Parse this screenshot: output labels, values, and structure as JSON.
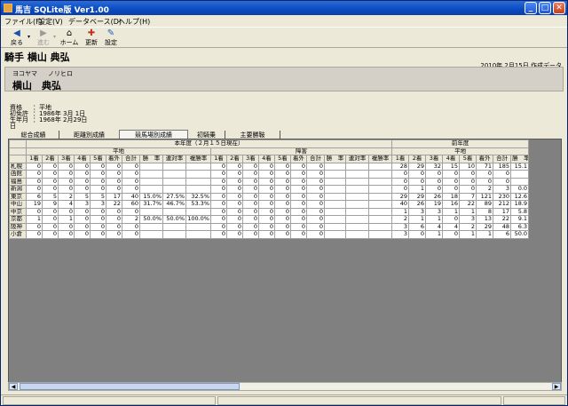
{
  "window": {
    "title": "馬吉 SQLite版  Ver1.00"
  },
  "menu": [
    "ファイル(F)",
    "設定(V)",
    "データベース(D)",
    "ヘルプ(H)"
  ],
  "toolbar": {
    "back": "戻る",
    "forward": "進む",
    "home": "ホーム",
    "refresh": "更新",
    "settings": "設定"
  },
  "page_title": "騎手 横山 典弘",
  "created_note": "2010年 2月15日 作成データ",
  "jockey": {
    "kana_last": "ヨコヤマ",
    "kana_first": "ノリヒロ",
    "name": "横山　典弘"
  },
  "info": [
    {
      "k": "資格",
      "v": "：平地"
    },
    {
      "k": "初免許",
      "v": "：1986年 3月 1日"
    },
    {
      "k": "生年月日",
      "v": "：1968年 2月29日"
    }
  ],
  "tabs": [
    "総合成績",
    "距離別成績",
    "競馬場別成績",
    "初騎乗",
    "主要勝鞍"
  ],
  "grid": {
    "year_header": "本年度（２月１５日現在）",
    "prev_header": "前年度",
    "flat": "平地",
    "jump": "障害",
    "flat_cols": [
      "1着",
      "2着",
      "3着",
      "4着",
      "5着",
      "着外",
      "合計",
      "勝　率",
      "連対率",
      "複勝率"
    ],
    "jump_cols": [
      "1着",
      "2着",
      "3着",
      "4着",
      "5着",
      "着外",
      "合計",
      "勝　率",
      "連対率",
      "複勝率"
    ],
    "prev_cols": [
      "1着",
      "2着",
      "3着",
      "4着",
      "5着",
      "着外",
      "合計",
      "勝　率"
    ],
    "rows": [
      {
        "c": "札幌",
        "f": [
          "0",
          "0",
          "0",
          "0",
          "0",
          "0",
          "0",
          "",
          "",
          ""
        ],
        "j": [
          "0",
          "0",
          "0",
          "0",
          "0",
          "0",
          "0",
          "",
          "",
          ""
        ],
        "p": [
          "28",
          "29",
          "32",
          "15",
          "10",
          "71",
          "185",
          "15.1"
        ]
      },
      {
        "c": "函館",
        "f": [
          "0",
          "0",
          "0",
          "0",
          "0",
          "0",
          "0",
          "",
          "",
          ""
        ],
        "j": [
          "0",
          "0",
          "0",
          "0",
          "0",
          "0",
          "0",
          "",
          "",
          ""
        ],
        "p": [
          "0",
          "0",
          "0",
          "0",
          "0",
          "0",
          "0",
          ""
        ]
      },
      {
        "c": "福島",
        "f": [
          "0",
          "0",
          "0",
          "0",
          "0",
          "0",
          "0",
          "",
          "",
          ""
        ],
        "j": [
          "0",
          "0",
          "0",
          "0",
          "0",
          "0",
          "0",
          "",
          "",
          ""
        ],
        "p": [
          "0",
          "0",
          "0",
          "0",
          "0",
          "0",
          "0",
          ""
        ]
      },
      {
        "c": "新潟",
        "f": [
          "0",
          "0",
          "0",
          "0",
          "0",
          "0",
          "0",
          "",
          "",
          ""
        ],
        "j": [
          "0",
          "0",
          "0",
          "0",
          "0",
          "0",
          "0",
          "",
          "",
          ""
        ],
        "p": [
          "0",
          "1",
          "0",
          "0",
          "0",
          "2",
          "3",
          "0.0"
        ]
      },
      {
        "c": "東京",
        "f": [
          "6",
          "5",
          "2",
          "5",
          "5",
          "17",
          "40",
          "15.0%",
          "27.5%",
          "32.5%"
        ],
        "j": [
          "0",
          "0",
          "0",
          "0",
          "0",
          "0",
          "0",
          "",
          "",
          ""
        ],
        "p": [
          "29",
          "29",
          "26",
          "18",
          "7",
          "121",
          "230",
          "12.6"
        ]
      },
      {
        "c": "中山",
        "f": [
          "19",
          "9",
          "4",
          "3",
          "3",
          "22",
          "60",
          "31.7%",
          "46.7%",
          "53.3%"
        ],
        "j": [
          "0",
          "0",
          "0",
          "0",
          "0",
          "0",
          "0",
          "",
          "",
          ""
        ],
        "p": [
          "40",
          "26",
          "19",
          "16",
          "22",
          "89",
          "212",
          "18.9"
        ]
      },
      {
        "c": "中京",
        "f": [
          "0",
          "0",
          "0",
          "0",
          "0",
          "0",
          "0",
          "",
          "",
          ""
        ],
        "j": [
          "0",
          "0",
          "0",
          "0",
          "0",
          "0",
          "0",
          "",
          "",
          ""
        ],
        "p": [
          "1",
          "3",
          "3",
          "1",
          "1",
          "8",
          "17",
          "5.8"
        ]
      },
      {
        "c": "京都",
        "f": [
          "1",
          "0",
          "1",
          "0",
          "0",
          "0",
          "2",
          "50.0%",
          "50.0%",
          "100.0%"
        ],
        "j": [
          "0",
          "0",
          "0",
          "0",
          "0",
          "0",
          "0",
          "",
          "",
          ""
        ],
        "p": [
          "2",
          "1",
          "1",
          "0",
          "3",
          "13",
          "22",
          "9.1"
        ]
      },
      {
        "c": "阪神",
        "f": [
          "0",
          "0",
          "0",
          "0",
          "0",
          "0",
          "0",
          "",
          "",
          ""
        ],
        "j": [
          "0",
          "0",
          "0",
          "0",
          "0",
          "0",
          "0",
          "",
          "",
          ""
        ],
        "p": [
          "3",
          "6",
          "4",
          "4",
          "2",
          "29",
          "48",
          "6.3"
        ]
      },
      {
        "c": "小倉",
        "f": [
          "0",
          "0",
          "0",
          "0",
          "0",
          "0",
          "0",
          "",
          "",
          ""
        ],
        "j": [
          "0",
          "0",
          "0",
          "0",
          "0",
          "0",
          "0",
          "",
          "",
          ""
        ],
        "p": [
          "3",
          "0",
          "1",
          "0",
          "1",
          "1",
          "6",
          "50.0"
        ]
      }
    ]
  }
}
